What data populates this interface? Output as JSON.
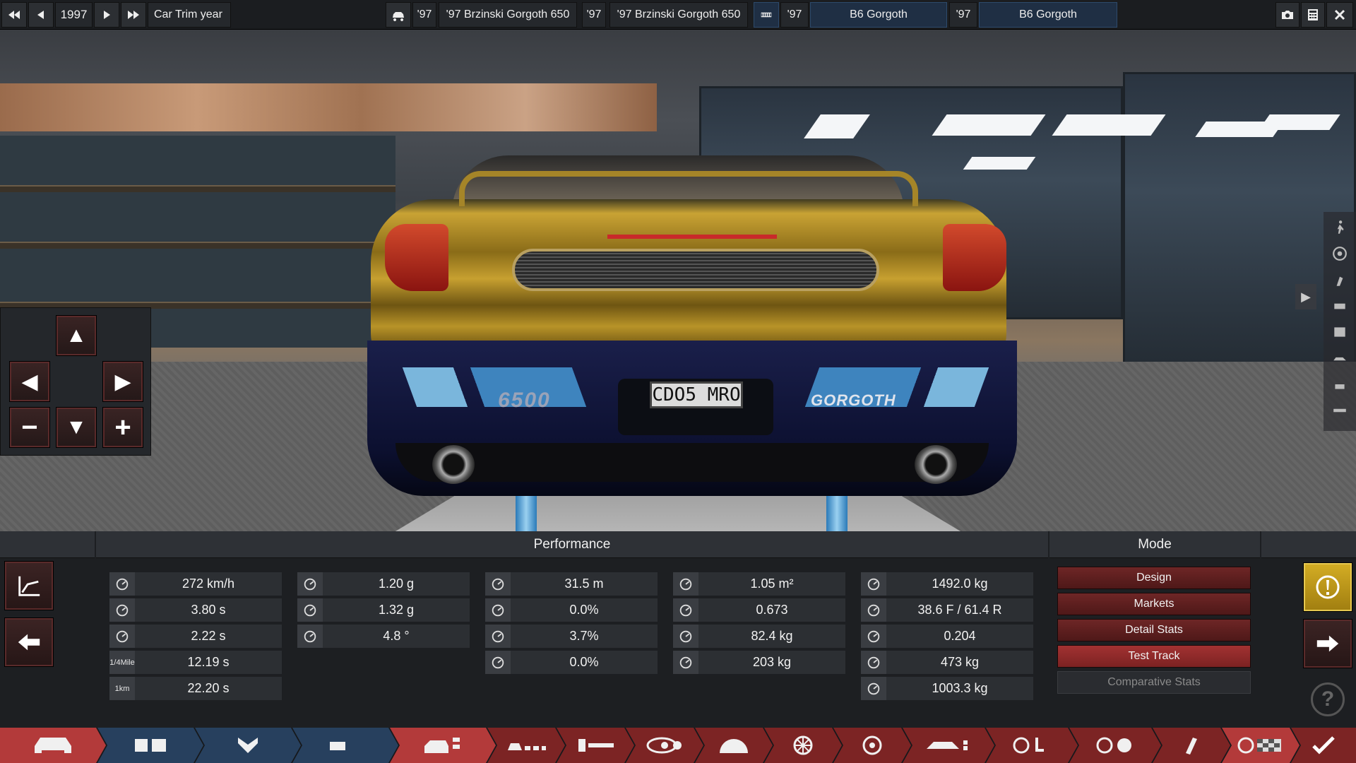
{
  "topbar": {
    "year": "1997",
    "year_label": "Car Trim year",
    "slot1_year": "'97",
    "slot1_name": "'97 Brzinski Gorgoth 650",
    "slot2_year": "'97",
    "slot2_name": "'97 Brzinski Gorgoth 650",
    "slot3_year": "'97",
    "slot3_name": "B6 Gorgoth",
    "slot4_year": "'97",
    "slot4_name": "B6 Gorgoth"
  },
  "car": {
    "plate": "CDO5 MRO",
    "badge_left": "6500",
    "badge_right": "GORGOTH"
  },
  "performance": {
    "title": "Performance",
    "col1": [
      {
        "icon": "top-speed-icon",
        "value": "272 km/h"
      },
      {
        "icon": "acceleration-0-100-icon",
        "value": "3.80 s"
      },
      {
        "icon": "acceleration-0-60-icon",
        "value": "2.22 s"
      },
      {
        "icon_text_top": "1/4",
        "icon_text_bottom": "Mile",
        "value": "12.19 s"
      },
      {
        "icon_text_top": "1",
        "icon_text_bottom": "km",
        "value": "22.20 s"
      }
    ],
    "col2": [
      {
        "icon": "cornering-low-icon",
        "value": "1.20 g"
      },
      {
        "icon": "cornering-high-icon",
        "value": "1.32 g"
      },
      {
        "icon": "body-roll-icon",
        "value": "4.8 °"
      }
    ],
    "col3": [
      {
        "icon": "braking-distance-icon",
        "value": "31.5 m"
      },
      {
        "icon": "brake-fade-icon",
        "value": "0.0%"
      },
      {
        "icon": "brake-fade-hot-icon",
        "value": "3.7%"
      },
      {
        "icon": "brake-lock-icon",
        "value": "0.0%"
      }
    ],
    "col4": [
      {
        "icon": "frontal-area-icon",
        "value": "1.05 m²"
      },
      {
        "icon": "drag-coefficient-icon",
        "value": "0.673"
      },
      {
        "icon": "front-downforce-icon",
        "value": "82.4 kg"
      },
      {
        "icon": "rear-downforce-icon",
        "value": "203 kg"
      }
    ],
    "col5": [
      {
        "icon": "weight-icon",
        "value": "1492.0 kg"
      },
      {
        "icon": "weight-distribution-icon",
        "value": "38.6 F / 61.4 R"
      },
      {
        "icon": "power-to-weight-icon",
        "value": "0.204"
      },
      {
        "icon": "engine-weight-icon",
        "value": "473 kg"
      },
      {
        "icon": "chassis-weight-icon",
        "value": "1003.3 kg"
      }
    ]
  },
  "mode": {
    "title": "Mode",
    "buttons": [
      "Design",
      "Markets",
      "Detail Stats",
      "Test Track",
      "Comparative Stats"
    ],
    "active": "Test Track"
  },
  "colors": {
    "accent_red": "#a23232",
    "warning_yellow": "#c9a21c",
    "tab_blue": "#27405e"
  }
}
